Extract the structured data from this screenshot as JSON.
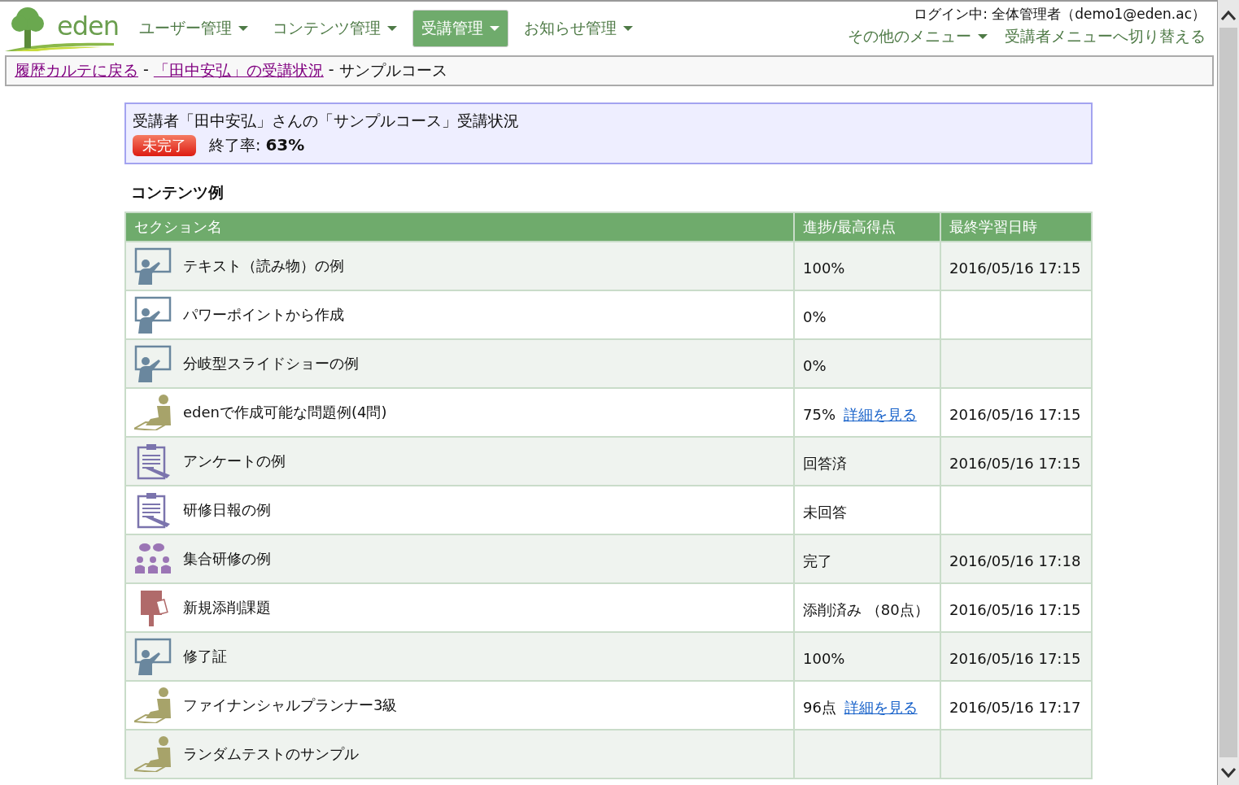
{
  "logo": {
    "text": "eden"
  },
  "nav": [
    {
      "label": "ユーザー管理",
      "selected": false
    },
    {
      "label": "コンテンツ管理",
      "selected": false
    },
    {
      "label": "受講管理",
      "selected": true
    },
    {
      "label": "お知らせ管理",
      "selected": false
    }
  ],
  "login": "ログイン中: 全体管理者（demo1@eden.ac）",
  "other_menu": "その他のメニュー",
  "switch_link": "受講者メニューへ切り替える",
  "breadcrumb": [
    {
      "text": "履歴カルテに戻る",
      "link": true
    },
    {
      "text": "「田中安弘」の受講状況",
      "link": true
    },
    {
      "text": "サンプルコース",
      "link": false
    }
  ],
  "breadcrumb_separators": [
    "-",
    "-"
  ],
  "summary": {
    "title": "受講者「田中安弘」さんの「サンプルコース」受講状況",
    "status": "未完了",
    "completed": false,
    "rate_label": "終了率:",
    "rate": "63%"
  },
  "section_title": "コンテンツ例",
  "table": {
    "columns": [
      "セクション名",
      "進捗/最高得点",
      "最終学習日時"
    ],
    "rows": [
      {
        "kind": "lecture",
        "name": "テキスト（読み物）の例",
        "progress": "100%",
        "date": "2016/05/16 17:15"
      },
      {
        "kind": "lecture",
        "name": "パワーポイントから作成",
        "progress": "0%"
      },
      {
        "kind": "lecture",
        "name": "分岐型スライドショーの例",
        "progress": "0%"
      },
      {
        "kind": "test",
        "name": "edenで作成可能な問題例(4問)",
        "progress": "75%",
        "detail": "詳細を見る",
        "date": "2016/05/16 17:15"
      },
      {
        "kind": "survey",
        "name": "アンケートの例",
        "progress": "回答済",
        "date": "2016/05/16 17:15"
      },
      {
        "kind": "survey",
        "name": "研修日報の例",
        "progress": "未回答"
      },
      {
        "kind": "group",
        "name": "集合研修の例",
        "progress": "完了",
        "date": "2016/05/16 17:18"
      },
      {
        "kind": "report",
        "name": "新規添削課題",
        "progress": "添削済み （80点）",
        "date": "2016/05/16 17:15"
      },
      {
        "kind": "lecture",
        "name": "修了証",
        "progress": "100%",
        "date": "2016/05/16 17:15"
      },
      {
        "kind": "test",
        "name": "ファイナンシャルプランナー3級",
        "progress": "96点",
        "detail": "詳細を見る",
        "date": "2016/05/16 17:17"
      },
      {
        "kind": "test",
        "name": "ランダムテストのサンプル"
      }
    ]
  }
}
